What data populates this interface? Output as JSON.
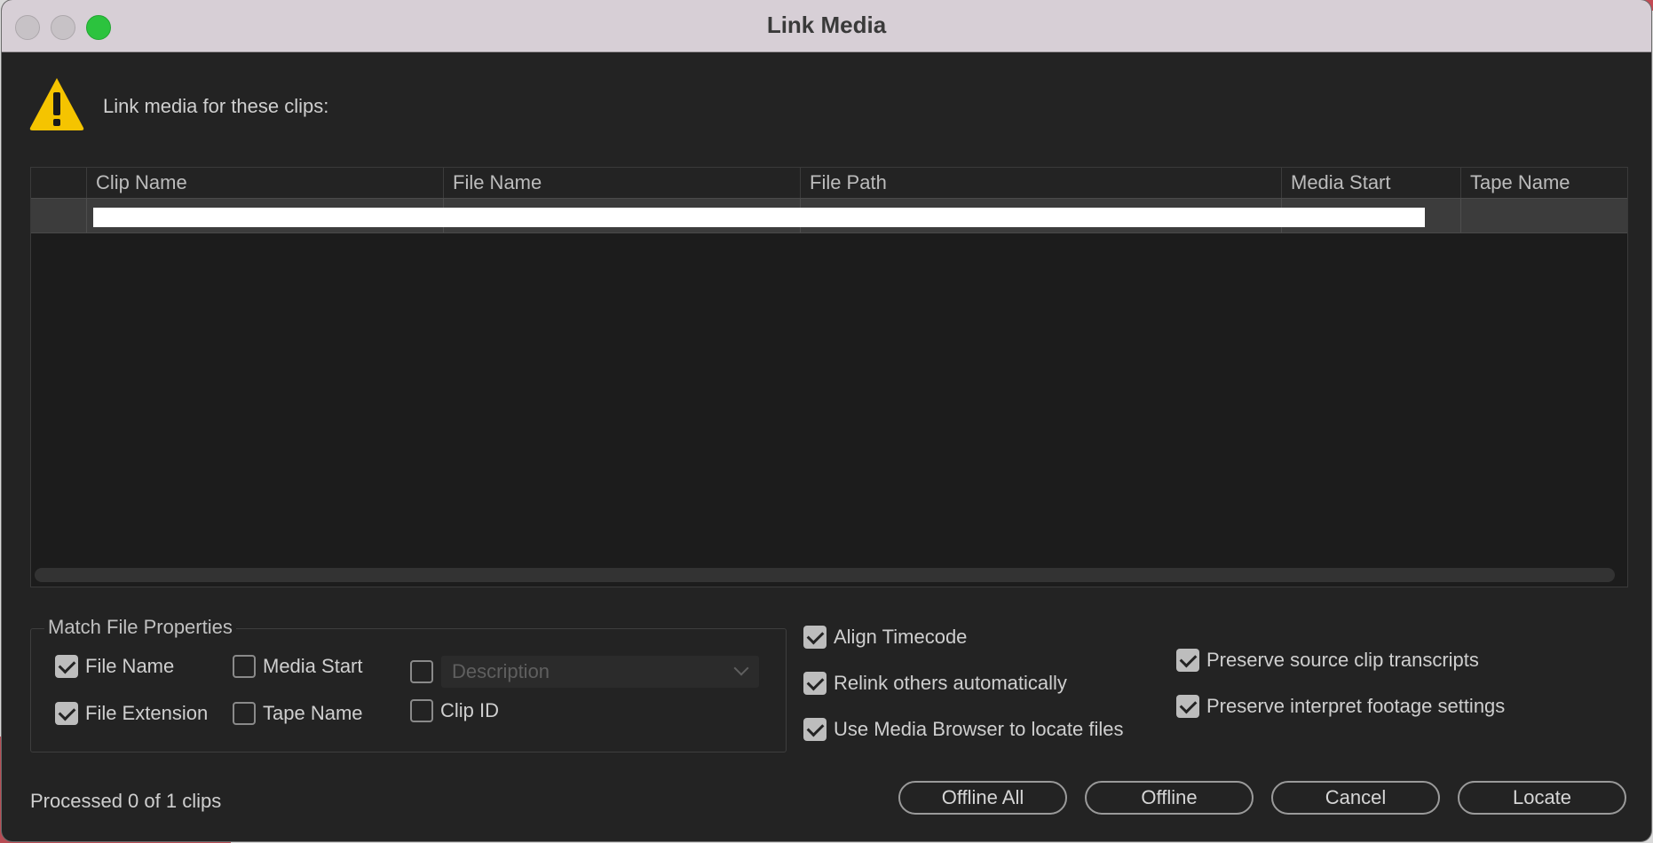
{
  "window": {
    "title": "Link Media"
  },
  "dialog": {
    "prompt": "Link media for these clips:"
  },
  "table": {
    "columns": [
      "Clip Name",
      "File Name",
      "File Path",
      "Media Start",
      "Tape Name"
    ]
  },
  "match_group": {
    "title": "Match File Properties",
    "file_name": {
      "label": "File Name",
      "checked": true
    },
    "file_extension": {
      "label": "File Extension",
      "checked": true
    },
    "media_start": {
      "label": "Media Start",
      "checked": false
    },
    "tape_name": {
      "label": "Tape Name",
      "checked": false
    },
    "description": {
      "checked": false,
      "placeholder": "Description"
    },
    "clip_id": {
      "label": "Clip ID",
      "checked": false
    }
  },
  "options": {
    "align_timecode": {
      "label": "Align Timecode",
      "checked": true
    },
    "relink_others": {
      "label": "Relink others automatically",
      "checked": true
    },
    "use_media_browser": {
      "label": "Use Media Browser to locate files",
      "checked": true
    },
    "preserve_transcripts": {
      "label": "Preserve source clip transcripts",
      "checked": true
    },
    "preserve_interpret": {
      "label": "Preserve interpret footage settings",
      "checked": true
    }
  },
  "status": "Processed 0 of 1 clips",
  "buttons": {
    "offline_all": "Offline All",
    "offline": "Offline",
    "cancel": "Cancel",
    "locate": "Locate"
  },
  "colors": {
    "accent_green": "#2cc33e",
    "warning_yellow": "#f5c400",
    "background": "#232323"
  },
  "icons": {
    "warning": "warning-triangle-icon"
  }
}
